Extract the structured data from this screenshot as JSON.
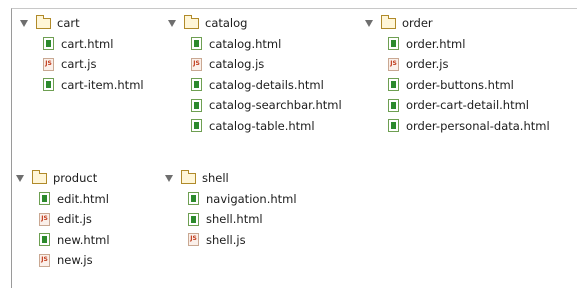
{
  "folders": [
    {
      "name": "cart",
      "files": [
        {
          "name": "cart.html",
          "type": "html"
        },
        {
          "name": "cart.js",
          "type": "js"
        },
        {
          "name": "cart-item.html",
          "type": "html"
        }
      ]
    },
    {
      "name": "catalog",
      "files": [
        {
          "name": "catalog.html",
          "type": "html"
        },
        {
          "name": "catalog.js",
          "type": "js"
        },
        {
          "name": "catalog-details.html",
          "type": "html"
        },
        {
          "name": "catalog-searchbar.html",
          "type": "html"
        },
        {
          "name": "catalog-table.html",
          "type": "html"
        }
      ]
    },
    {
      "name": "order",
      "files": [
        {
          "name": "order.html",
          "type": "html"
        },
        {
          "name": "order.js",
          "type": "js"
        },
        {
          "name": "order-buttons.html",
          "type": "html"
        },
        {
          "name": "order-cart-detail.html",
          "type": "html"
        },
        {
          "name": "order-personal-data.html",
          "type": "html"
        }
      ]
    },
    {
      "name": "product",
      "files": [
        {
          "name": "edit.html",
          "type": "html"
        },
        {
          "name": "edit.js",
          "type": "js"
        },
        {
          "name": "new.html",
          "type": "html"
        },
        {
          "name": "new.js",
          "type": "js"
        }
      ]
    },
    {
      "name": "shell",
      "files": [
        {
          "name": "navigation.html",
          "type": "html"
        },
        {
          "name": "shell.html",
          "type": "html"
        },
        {
          "name": "shell.js",
          "type": "js"
        }
      ]
    }
  ]
}
